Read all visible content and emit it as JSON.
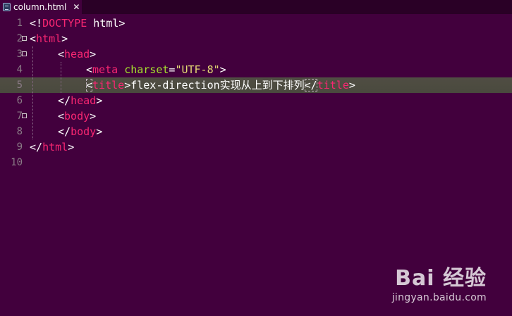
{
  "tab": {
    "file_icon": "html-file-icon",
    "label": "column.html",
    "close_glyph": "✕"
  },
  "editor": {
    "line_numbers": [
      "1",
      "2",
      "3",
      "4",
      "5",
      "6",
      "7",
      "8",
      "9",
      "10"
    ],
    "current_line": 5,
    "folded_lines": [
      2,
      3,
      7
    ],
    "lines": [
      {
        "indent": 0,
        "tokens": [
          [
            "punct",
            "<!"
          ],
          [
            "doctype",
            "DOCTYPE"
          ],
          [
            "punct",
            " html>"
          ]
        ]
      },
      {
        "indent": 0,
        "tokens": [
          [
            "punct",
            "<"
          ],
          [
            "tag",
            "html"
          ],
          [
            "punct",
            ">"
          ]
        ]
      },
      {
        "indent": 1,
        "tokens": [
          [
            "punct",
            "<"
          ],
          [
            "tag",
            "head"
          ],
          [
            "punct",
            ">"
          ]
        ]
      },
      {
        "indent": 2,
        "tokens": [
          [
            "punct",
            "<"
          ],
          [
            "tag",
            "meta"
          ],
          [
            "punct",
            " "
          ],
          [
            "attr",
            "charset"
          ],
          [
            "punct",
            "="
          ],
          [
            "str",
            "\"UTF-8\""
          ],
          [
            "punct",
            ">"
          ]
        ]
      },
      {
        "indent": 2,
        "tokens": [
          [
            "punct hl-open",
            "<"
          ],
          [
            "tag",
            "title"
          ],
          [
            "punct",
            ">"
          ],
          [
            "punct",
            "flex-direction实现从上到下排列"
          ],
          [
            "punct hl-close",
            "</"
          ],
          [
            "tag",
            "title"
          ],
          [
            "punct",
            ">"
          ]
        ]
      },
      {
        "indent": 1,
        "tokens": [
          [
            "punct",
            "</"
          ],
          [
            "tag",
            "head"
          ],
          [
            "punct",
            ">"
          ]
        ]
      },
      {
        "indent": 1,
        "tokens": [
          [
            "punct",
            "<"
          ],
          [
            "tag",
            "body"
          ],
          [
            "punct",
            ">"
          ]
        ]
      },
      {
        "indent": 1,
        "tokens": [
          [
            "punct",
            "</"
          ],
          [
            "tag",
            "body"
          ],
          [
            "punct",
            ">"
          ]
        ]
      },
      {
        "indent": 0,
        "tokens": [
          [
            "punct",
            "</"
          ],
          [
            "tag",
            "html"
          ],
          [
            "punct",
            ">"
          ]
        ]
      },
      {
        "indent": 0,
        "tokens": []
      }
    ]
  },
  "colors": {
    "background": "#42003d",
    "current_line": "#4d4d40",
    "tag": "#f92672",
    "attribute": "#a6e22e",
    "string": "#e6db74",
    "text": "#ffffff",
    "line_number": "#8a7a86"
  },
  "watermark": {
    "logo": "Bai 经验",
    "paw": "🐾",
    "url": "jingyan.baidu.com"
  }
}
